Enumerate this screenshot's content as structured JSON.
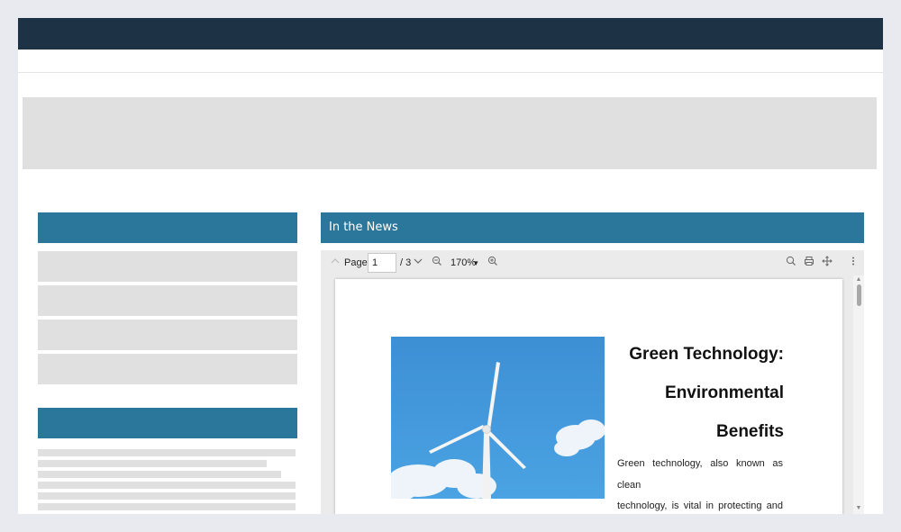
{
  "news": {
    "header": "In the News",
    "toolbar": {
      "page_label": "Page",
      "page_value": "1",
      "page_total": "/ 3",
      "zoom": "170%",
      "zoom_arrow": "▾",
      "icons": [
        "chevron-up-icon",
        "chevron-down-icon",
        "zoom-out-icon",
        "zoom-in-icon",
        "search-icon",
        "print-icon",
        "pan-icon",
        "more-vertical-icon"
      ]
    },
    "document": {
      "title_lines": [
        "Green Technology:",
        "Environmental",
        "Benefits"
      ],
      "body_lines": [
        "Green technology, also known as clean",
        "technology, is vital in protecting and"
      ],
      "image": "wind-turbine-photo"
    }
  },
  "colors": {
    "topbar": "#1e3246",
    "accent": "#2b779c",
    "placeholder": "#e0e0e0",
    "background": "#e9eaf0"
  }
}
